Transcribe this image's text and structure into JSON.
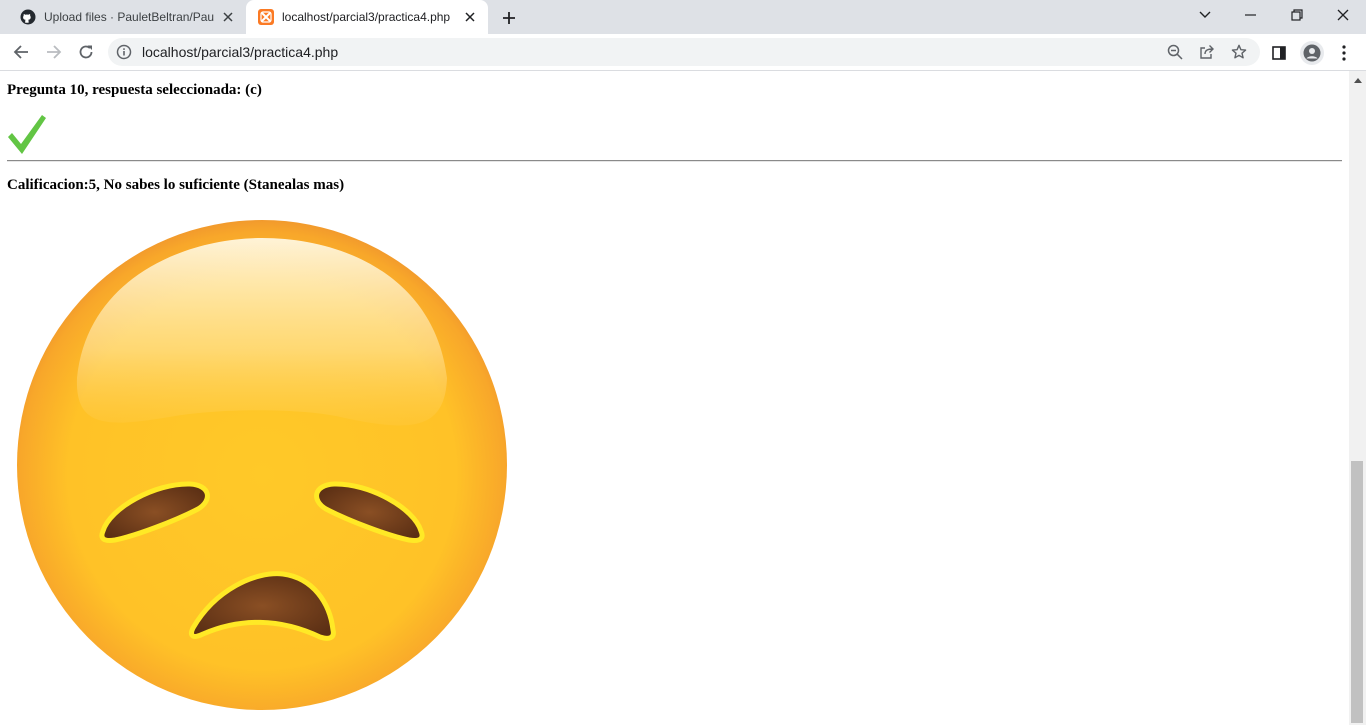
{
  "browser": {
    "tabs": [
      {
        "title": "Upload files · PauletBeltran/Paule"
      },
      {
        "title": "localhost/parcial3/practica4.php",
        "active": true
      }
    ],
    "url": "localhost/parcial3/practica4.php",
    "accent": "#dee1e6"
  },
  "page": {
    "question_result": "Pregunta 10, respuesta seleccionada: (c)",
    "result_icon": "green-checkmark",
    "check_color": "#62c544",
    "grade_text": "Calificacion:5, No sabes lo suficiente (Stanealas mas)",
    "grade_image": "disappointed-face-emoji"
  }
}
